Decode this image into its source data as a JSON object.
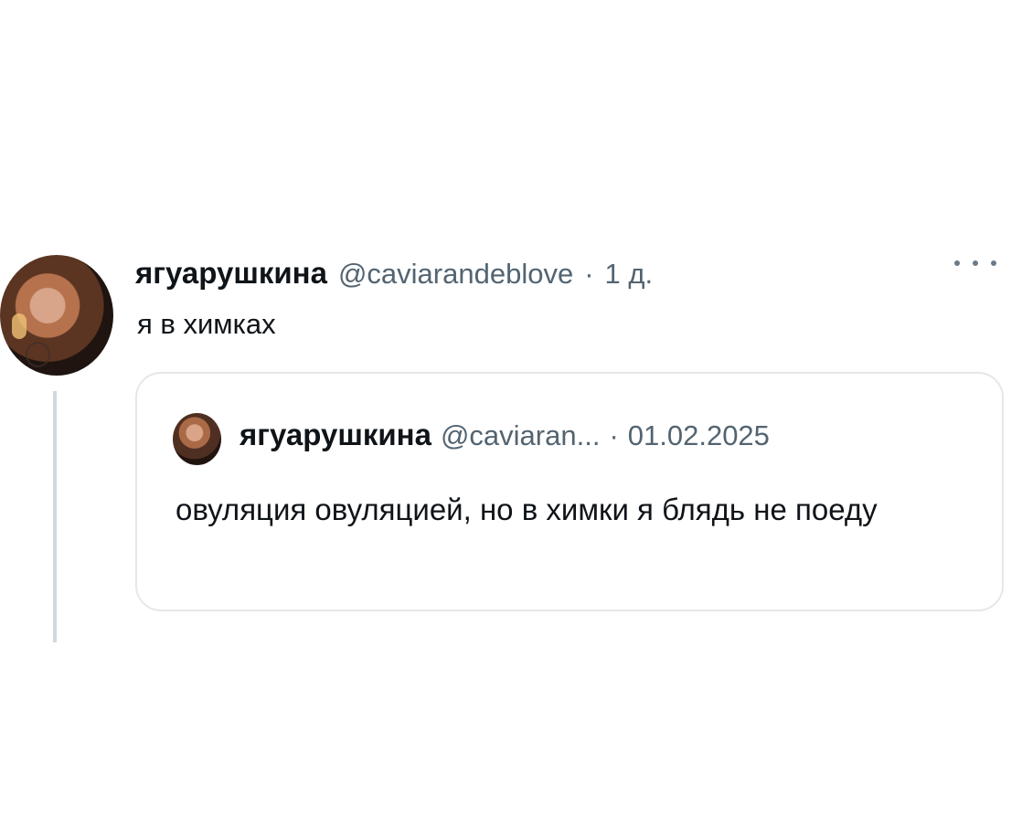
{
  "tweet": {
    "author": {
      "display_name": "ягуарушкина",
      "handle": "@caviarandeblove",
      "separator": "·",
      "timestamp": "1 д."
    },
    "text": "я в химках",
    "more_icon": "more-horizontal-icon",
    "quoted_tweet": {
      "author": {
        "display_name": "ягуарушкина",
        "handle": "@caviaran...",
        "separator": "·",
        "date": "01.02.2025"
      },
      "text": "овуляция овуляцией, но в химки я блядь не поеду"
    }
  },
  "colors": {
    "text": "#0f1419",
    "muted": "#536471",
    "border": "#e5e7e9",
    "thread_line": "#cfd9de",
    "background": "#ffffff"
  }
}
